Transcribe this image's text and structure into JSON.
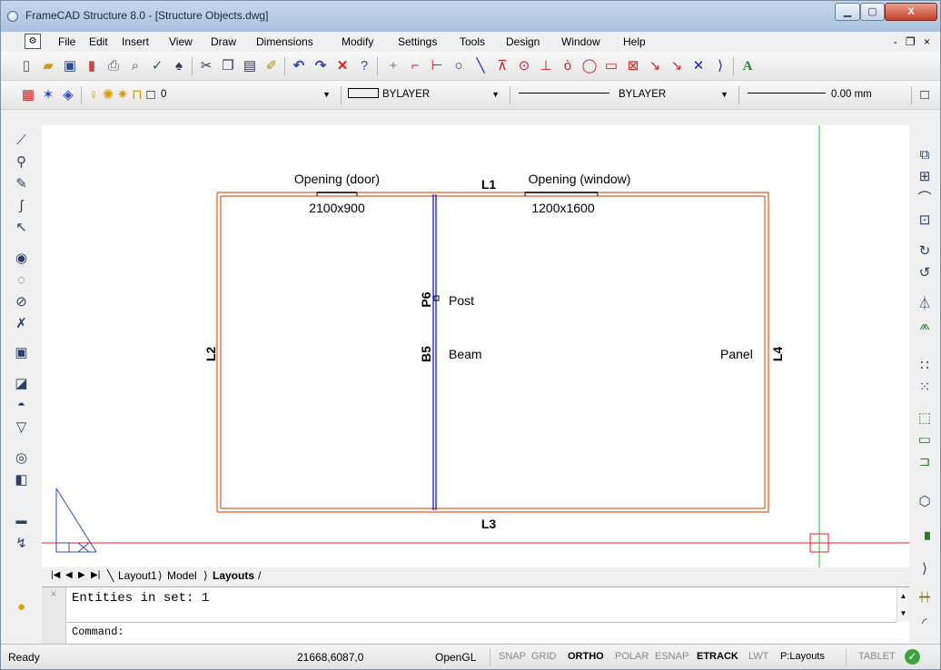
{
  "window": {
    "title": "FrameCAD Structure 8.0 - [Structure Objects.dwg]"
  },
  "titlebar": {
    "minimize": "▁",
    "maximize": "▢",
    "close": "X"
  },
  "menu": {
    "items": [
      "File",
      "Edit",
      "Insert",
      "View",
      "Draw",
      "Dimensions",
      "Modify",
      "Settings",
      "Tools",
      "Design",
      "Window",
      "Help"
    ],
    "right_controls": "- ❐ ×"
  },
  "properties": {
    "layer_value": "0",
    "color_value": "BYLAYER",
    "linetype_value": "BYLAYER",
    "lineweight_value": "0.00 mm"
  },
  "drawing": {
    "labels": {
      "opening_door": "Opening (door)",
      "opening_door_size": "2100x900",
      "opening_window": "Opening (window)",
      "opening_window_size": "1200x1600",
      "l1": "L1",
      "l2": "L2",
      "l3": "L3",
      "l4": "L4",
      "p6": "P6",
      "post": "Post",
      "b5": "B5",
      "beam": "Beam",
      "panel": "Panel"
    },
    "colors": {
      "wall": "#e05a1e",
      "beam": "#2a2ad0",
      "crosshair_v": "#2ec22e",
      "crosshair_h": "#e02020"
    }
  },
  "tabs": {
    "items": [
      "Layout1",
      "Model",
      "Layouts"
    ],
    "active": "Layouts"
  },
  "command": {
    "output": "Entities in set: 1",
    "prompt": "Command:"
  },
  "status": {
    "ready": "Ready",
    "coords": "21668,6087,0",
    "renderer": "OpenGL",
    "toggles": [
      {
        "label": "SNAP",
        "on": false
      },
      {
        "label": "GRID",
        "on": false
      },
      {
        "label": "ORTHO",
        "on": true
      },
      {
        "label": "POLAR",
        "on": false
      },
      {
        "label": "ESNAP",
        "on": false
      },
      {
        "label": "ETRACK",
        "on": true
      },
      {
        "label": "LWT",
        "on": false
      },
      {
        "label": "P:Layouts",
        "on": true
      }
    ],
    "tablet": "TABLET"
  },
  "icons": {
    "toolbar1": [
      "new-icon",
      "open-icon",
      "save-icon",
      "print-preview-icon",
      "print-icon",
      "zoom-icon",
      "spell-check-icon",
      "find-icon",
      "cut-icon",
      "copy-icon",
      "paste-icon",
      "match-properties-icon",
      "undo-icon",
      "redo-icon",
      "delete-icon",
      "help-icon",
      "line-icon",
      "polyline-icon",
      "circle-icon",
      "arc-icon",
      "point-icon",
      "ellipse-icon",
      "rectangle-icon"
    ],
    "left": [
      "line-tool-icon",
      "zoom-window-icon",
      "pencil-icon",
      "spline-icon",
      "hatch-icon",
      "target-icon",
      "pan-icon",
      "orbit-icon",
      "trim-icon",
      "block-icon",
      "region-icon",
      "view-icon",
      "plane-icon",
      "ring-icon",
      "solid-icon",
      "layers-icon",
      "snap-icon",
      "color-icon"
    ],
    "right": [
      "copy-icon",
      "array-icon",
      "mirror-icon",
      "stretch-icon",
      "rotate-icon",
      "rotate-ccw-icon",
      "mirror-axis-icon",
      "offset-icon",
      "grid-icon",
      "points-icon",
      "rect-icon",
      "box-icon",
      "extend-icon",
      "solid-edit-icon",
      "chamfer-icon",
      "break-icon",
      "measure-icon",
      "fillet-icon"
    ]
  }
}
